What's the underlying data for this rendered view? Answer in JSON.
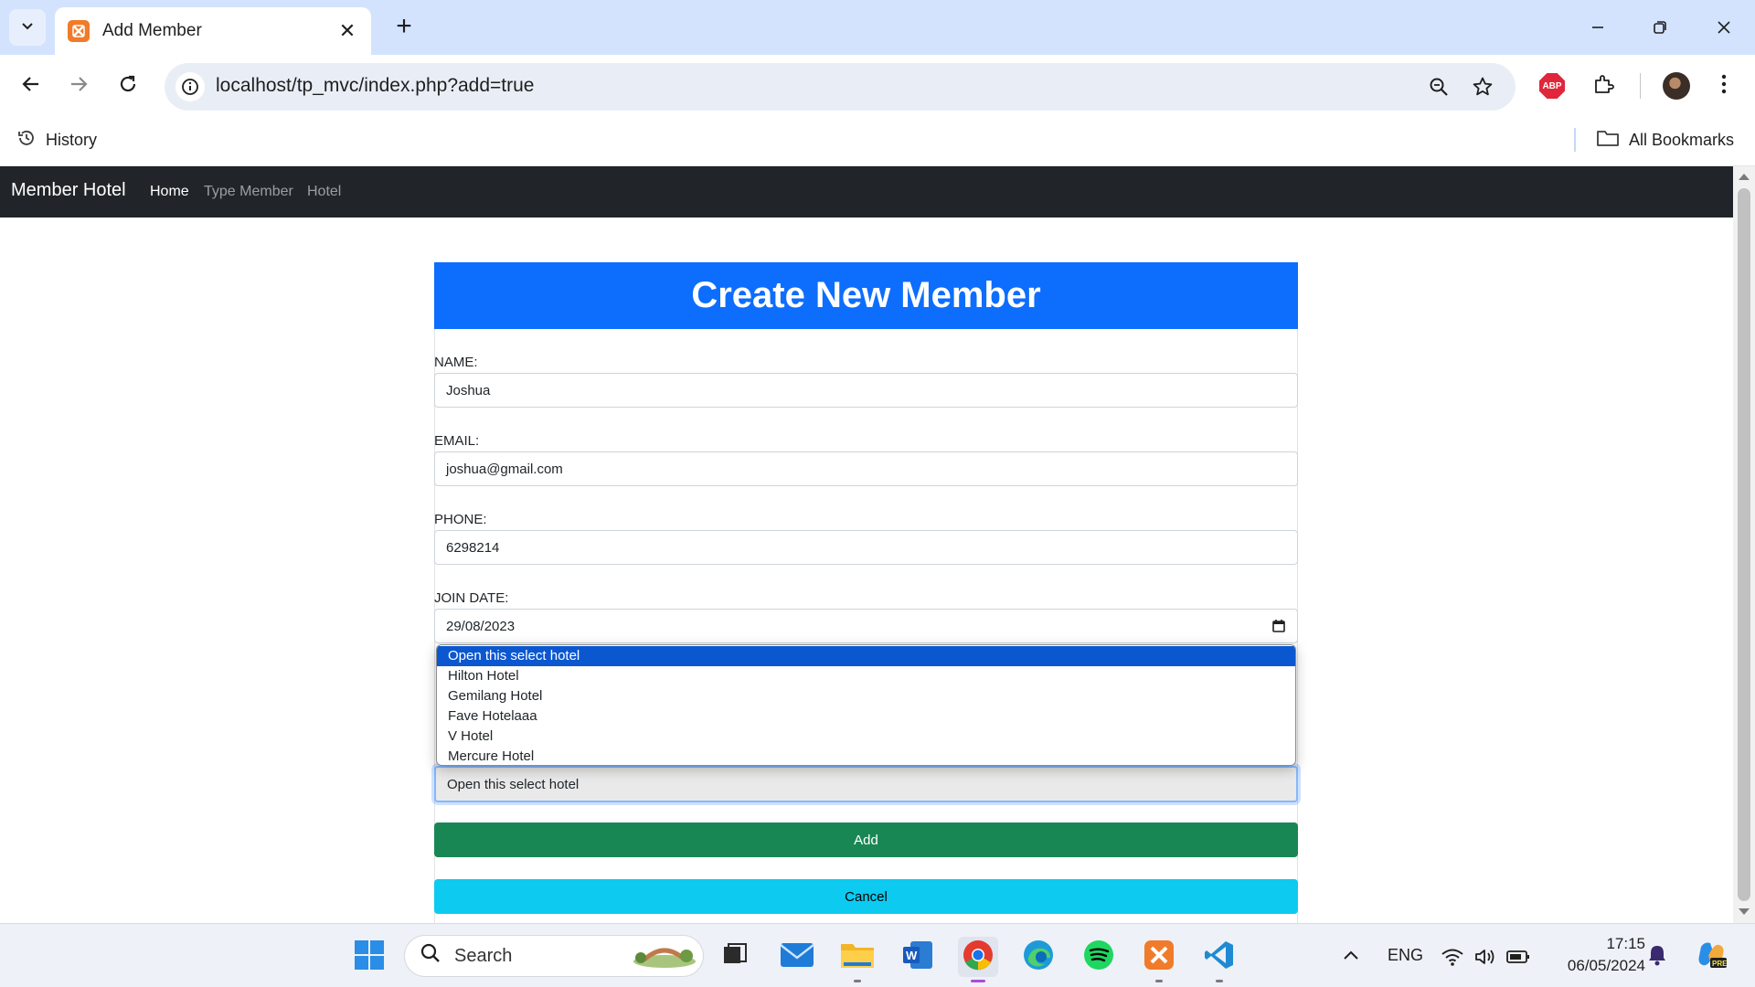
{
  "browser": {
    "tab": {
      "title": "Add Member"
    },
    "url": "localhost/tp_mvc/index.php?add=true",
    "bookmarks": {
      "history": "History",
      "all_bookmarks": "All Bookmarks"
    },
    "extension_abp": "ABP"
  },
  "navbar": {
    "brand": "Member Hotel",
    "links": [
      "Home",
      "Type Member",
      "Hotel"
    ]
  },
  "form": {
    "title": "Create New Member",
    "name": {
      "label": "NAME:",
      "value": "Joshua"
    },
    "email": {
      "label": "EMAIL:",
      "value": "joshua@gmail.com"
    },
    "phone": {
      "label": "PHONE:",
      "value": "6298214"
    },
    "join_date": {
      "label": "JOIN DATE:",
      "value": "29/08/2023"
    },
    "hotel": {
      "selected": "Open this select hotel",
      "options": [
        "Open this select hotel",
        "Hilton Hotel",
        "Gemilang Hotel",
        "Fave Hotelaaa",
        "V Hotel",
        "Mercure Hotel"
      ]
    },
    "add_label": "Add",
    "cancel_label": "Cancel"
  },
  "taskbar": {
    "search_placeholder": "Search",
    "language": "ENG",
    "time": "17:15",
    "date": "06/05/2024"
  },
  "colors": {
    "header_blue": "#0d6efd",
    "add_green": "#198754",
    "cancel_cyan": "#0dcaf0",
    "navbar_dark": "#212529"
  }
}
